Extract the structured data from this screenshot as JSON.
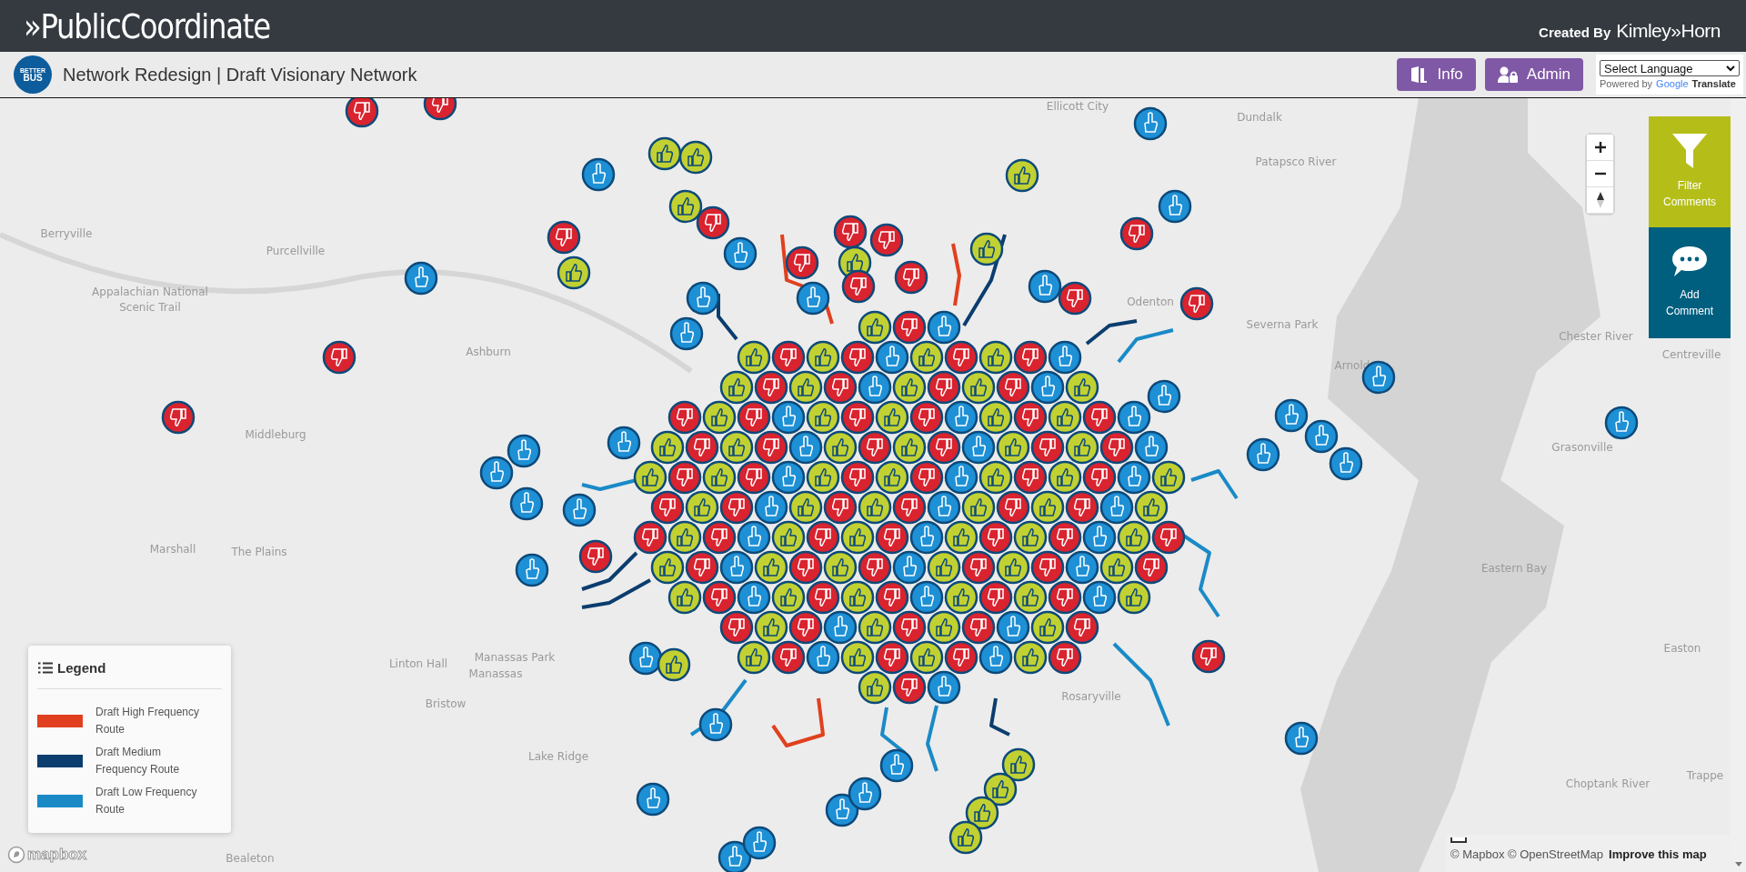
{
  "header": {
    "logo": "»PublicCoordinate",
    "credit_prefix": "Created By",
    "credit_brand": "Kimley»Horn"
  },
  "subheader": {
    "badge_lines": [
      "BETTER",
      "BUS"
    ],
    "title": "Network Redesign | Draft Visionary Network",
    "buttons": [
      {
        "label": "Info",
        "kind": "info"
      },
      {
        "label": "Admin",
        "kind": "admin"
      }
    ],
    "language_select": {
      "value": "Select Language"
    },
    "powered_by": "Powered by",
    "google": "Google",
    "translate": "Translate"
  },
  "map": {
    "place_labels": [
      "Ellicott City",
      "Dundalk",
      "Patapsco River",
      "Berryville",
      "Purcellville",
      "Appalachian National",
      "Scenic Trail",
      "Odenton",
      "Severna Park",
      "Ashburn",
      "Arnold",
      "Chester River",
      "Centreville",
      "Middleburg",
      "Grasonville",
      "Marshall",
      "The Plains",
      "Eastern Bay",
      "Linton Hall",
      "Manassas Park",
      "Manassas",
      "Bristow",
      "Rosaryville",
      "Easton",
      "Trappe",
      "Lake Ridge",
      "Choptank River",
      "Bealeton"
    ],
    "side_actions": [
      {
        "label": "Filter Comments",
        "kind": "filter"
      },
      {
        "label": "Add Comment",
        "kind": "comment"
      }
    ],
    "legend": {
      "title": "Legend",
      "items": [
        {
          "label": "Draft High Frequency Route",
          "color": "#e0401f"
        },
        {
          "label": "Draft Medium Frequency Route",
          "color": "#0b3d6e"
        },
        {
          "label": "Draft Low Frequency Route",
          "color": "#1a8ac7"
        }
      ]
    },
    "mapbox_logo": "mapbox",
    "attribution": "© Mapbox © OpenStreetMap",
    "improve_link": "Improve this map"
  }
}
